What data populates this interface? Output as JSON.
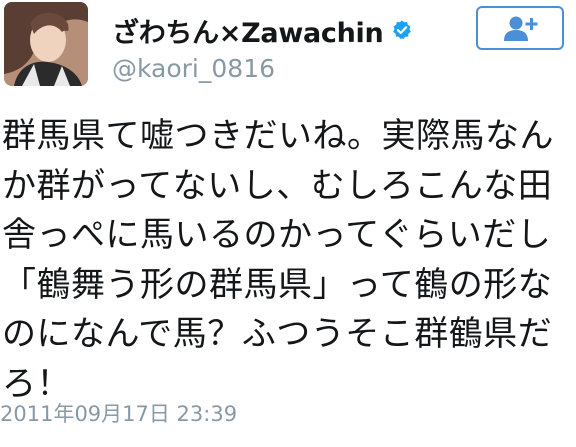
{
  "user": {
    "display_name": "ざわちん×Zawachin",
    "handle": "@kaori_0816",
    "verified_icon": "verified-badge-icon",
    "avatar_icon": "profile-photo"
  },
  "follow_button": {
    "icon": "add-user-icon",
    "accent": "#4b8fd6"
  },
  "tweet": {
    "lines": [
      "群馬県て嘘つきだいね。実際馬なん",
      "か群がってないし、むしろこんな田",
      "舎っぺに馬いるのかってぐらいだし",
      "「鶴舞う形の群馬県」って鶴の形な",
      "のになんで馬？ふつうそこ群鶴県だ",
      "ろ！"
    ],
    "timestamp": "2011年09月17日 23:39"
  },
  "colors": {
    "text": "#14171a",
    "secondary": "#8899a6",
    "verified": "#1da1f2"
  }
}
